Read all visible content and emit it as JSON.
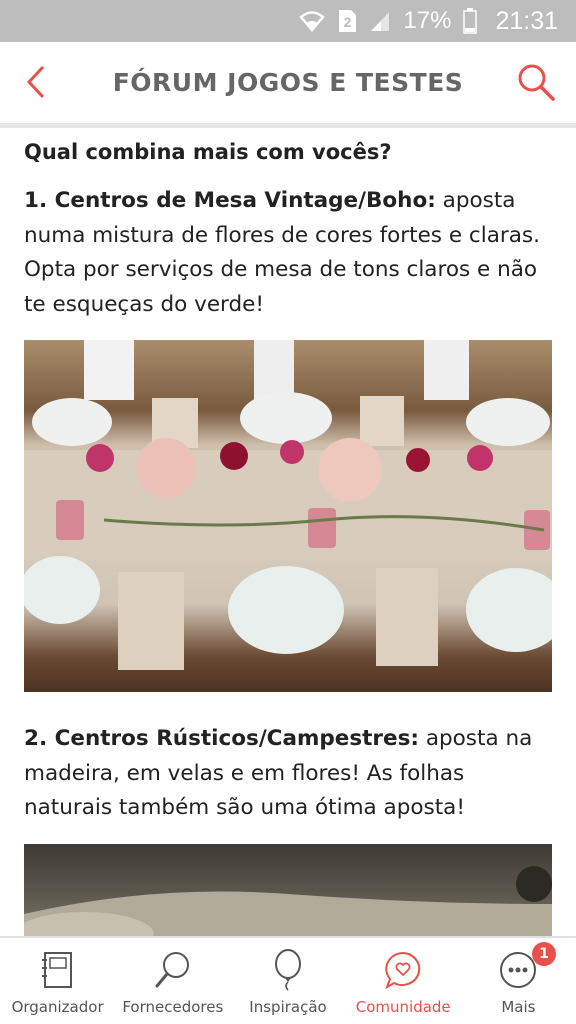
{
  "status_bar": {
    "sim_label": "2",
    "battery": "17%",
    "time": "21:31"
  },
  "header": {
    "title": "FÓRUM JOGOS E TESTES",
    "back_icon": "chevron-left-icon",
    "search_icon": "search-icon",
    "accent_color": "#e8514a"
  },
  "post": {
    "question": "Qual combina mais com vocês?",
    "items": [
      {
        "heading": "1. Centros de Mesa Vintage/Boho:",
        "text": " aposta numa mistura de flores de cores fortes e claras. Opta por serviços de mesa de tons claros e não te esqueças do verde!"
      },
      {
        "heading": "2. Centros Rústicos/Campestres:",
        "text": " aposta na madeira, em velas e em flores! As folhas naturais também são uma ótima aposta!"
      }
    ]
  },
  "bottom_nav": {
    "items": [
      {
        "label": "Organizador",
        "icon": "notebook-icon"
      },
      {
        "label": "Fornecedores",
        "icon": "search-icon"
      },
      {
        "label": "Inspiração",
        "icon": "balloon-icon"
      },
      {
        "label": "Comunidade",
        "icon": "chat-heart-icon",
        "active": true
      },
      {
        "label": "Mais",
        "icon": "more-icon",
        "badge": "1"
      }
    ]
  }
}
